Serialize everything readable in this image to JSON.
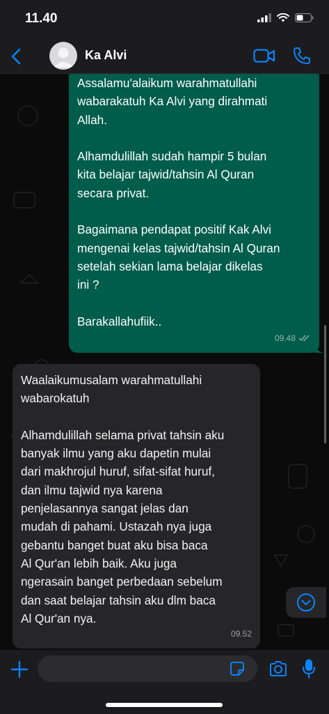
{
  "status_bar": {
    "time": "11.40"
  },
  "header": {
    "contact_name": "Ka Alvi"
  },
  "messages": [
    {
      "direction": "outgoing",
      "text": "Assalamu'alaikum warahmatullahi\nwabarakatuh Ka Alvi yang dirahmati\nAllah.\n\nAlhamdulillah sudah hampir 5 bulan\nkita belajar tajwid/tahsin Al Quran\nsecara privat.\n\nBagaimana pendapat positif Kak Alvi\nmengenai kelas tajwid/tahsin Al Quran\nsetelah sekian lama belajar dikelas\nini ?\n\nBarakallahufiik..",
      "time": "09.48"
    },
    {
      "direction": "incoming",
      "text": "Waalaikumusalam warahmatullahi\nwabarokatuh\n\nAlhamdulillah selama privat tahsin aku\nbanyak ilmu yang aku dapetin mulai\ndari makhrojul huruf, sifat-sifat huruf,\ndan ilmu tajwid nya karena\npenjelasannya sangat jelas dan\nmudah di pahami. Ustazah nya juga\ngebantu banget buat aku bisa baca\nAl Qur'an lebih baik. Aku juga\nngerasain banget perbedaan sebelum\ndan saat belajar tahsin aku dlm baca\nAl Qur'an nya.",
      "time": "09.52"
    }
  ],
  "composer": {
    "value": "",
    "placeholder": ""
  },
  "colors": {
    "accent": "#0a84ff",
    "outgoing_bubble": "#005c4b",
    "incoming_bubble": "#262628",
    "bar_background": "#1c1c1e"
  },
  "icons": [
    "back-chevron-icon",
    "avatar-icon",
    "video-call-icon",
    "phone-icon",
    "chevron-down-icon",
    "plus-icon",
    "sticker-icon",
    "camera-icon",
    "mic-icon",
    "read-receipt-icon",
    "signal-icon",
    "wifi-icon",
    "battery-icon"
  ]
}
